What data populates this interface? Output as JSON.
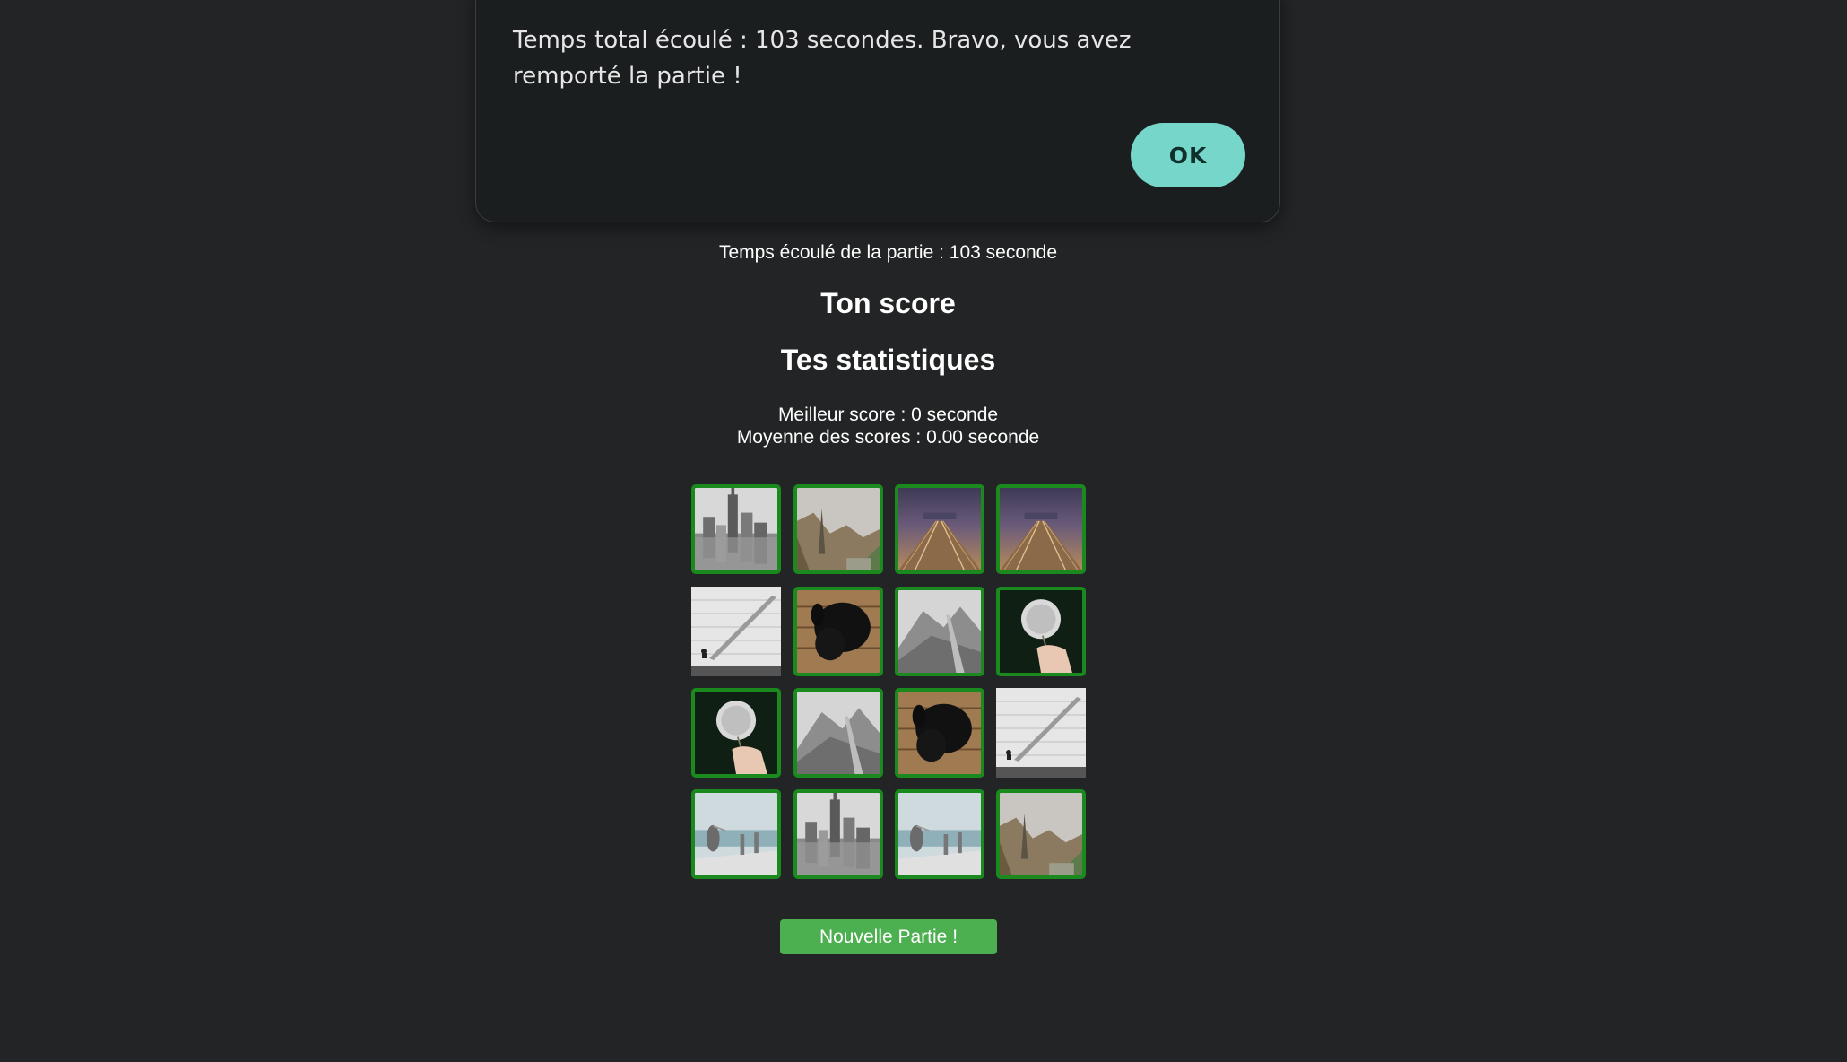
{
  "dialog": {
    "message": "Temps total écoulé : 103 secondes. Bravo, vous avez remporté la partie !",
    "ok_label": "OK"
  },
  "game": {
    "elapsed_text": "Temps écoulé de la partie : 103 seconde",
    "score_heading": "Ton score",
    "stats_heading": "Tes statistiques",
    "best_score_text": "Meilleur score : 0 seconde",
    "average_score_text": "Moyenne des scores : 0.00 seconde",
    "new_game_label": "Nouvelle Partie !"
  },
  "cards": [
    {
      "image": "city-skyline-bw",
      "matched": true
    },
    {
      "image": "misty-forest-path",
      "matched": true
    },
    {
      "image": "railway-tracks-dusk",
      "matched": true
    },
    {
      "image": "railway-tracks-dusk",
      "matched": true
    },
    {
      "image": "white-brick-wall-bird",
      "matched": false
    },
    {
      "image": "black-dog",
      "matched": true
    },
    {
      "image": "mountain-path-bw",
      "matched": true
    },
    {
      "image": "dandelion-in-hand",
      "matched": true
    },
    {
      "image": "dandelion-in-hand",
      "matched": true
    },
    {
      "image": "mountain-path-bw",
      "matched": true
    },
    {
      "image": "black-dog",
      "matched": true
    },
    {
      "image": "white-brick-wall-bird",
      "matched": false
    },
    {
      "image": "pelican-pier",
      "matched": true
    },
    {
      "image": "city-skyline-bw",
      "matched": true
    },
    {
      "image": "pelican-pier",
      "matched": true
    },
    {
      "image": "misty-forest-path",
      "matched": true
    }
  ],
  "colors": {
    "background": "#232425",
    "dialog_background": "#1b1e1f",
    "ok_button": "#75d6c9",
    "matched_border": "#1a8a1f",
    "new_game_button": "#4caf50"
  }
}
